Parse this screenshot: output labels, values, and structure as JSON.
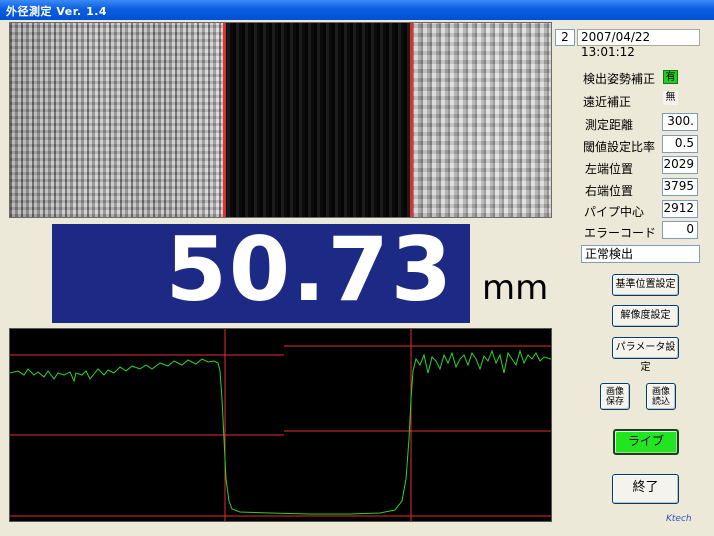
{
  "window": {
    "title": "外径測定  Ver. 1.4"
  },
  "header": {
    "counter": "2",
    "datetime": "2007/04/22 13:01:12"
  },
  "settings": {
    "detect_posture_correction": {
      "label": "検出姿勢補正",
      "value": "有"
    },
    "perspective_correction": {
      "label": "遠近補正",
      "value": "無"
    },
    "measure_distance": {
      "label": "測定距離",
      "value": "300."
    },
    "threshold_ratio": {
      "label": "閾値設定比率",
      "value": "0.5"
    },
    "left_edge": {
      "label": "左端位置",
      "value": "2029"
    },
    "right_edge": {
      "label": "右端位置",
      "value": "3795"
    },
    "pipe_center": {
      "label": "パイプ中心",
      "value": "2912"
    },
    "error_code": {
      "label": "エラーコード",
      "value": "0"
    }
  },
  "status": "正常検出",
  "measurement": {
    "value": "50.73",
    "unit": "mm"
  },
  "buttons": {
    "reference_position": "基準位置設定",
    "resolution": "解像度設定",
    "parameters": "パラメータ設定",
    "save_image": "画像\n保存",
    "load_image": "画像\n読込",
    "live": "ライブ",
    "exit": "終了"
  },
  "brand": "Ktech",
  "colors": {
    "display_bg": "#1c2a85",
    "live_button": "#22e522",
    "edge_line": "#e03030",
    "profile_line": "#2bd42b",
    "posture_flag": "#22cc22"
  }
}
